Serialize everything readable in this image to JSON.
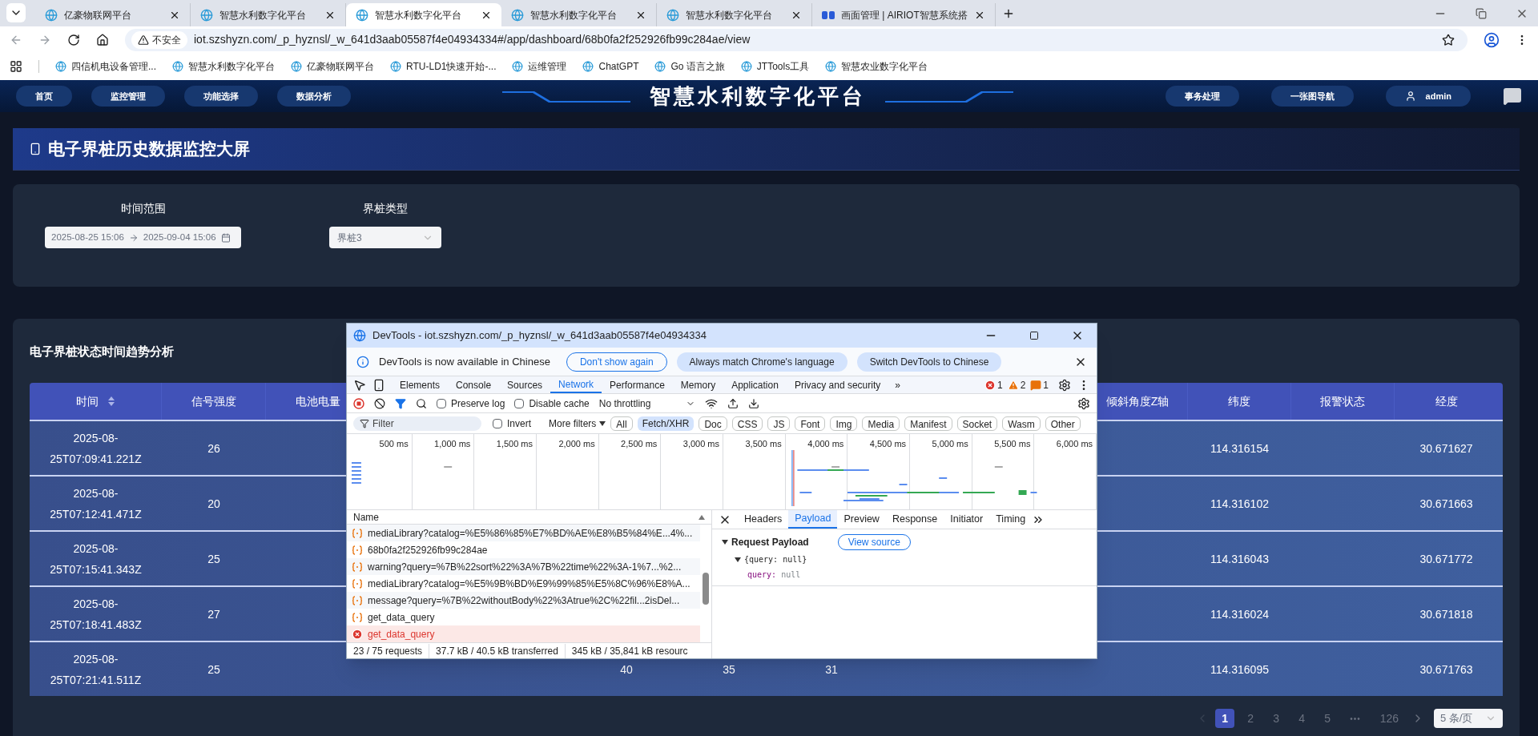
{
  "browser": {
    "tabs": [
      {
        "title": "亿豪物联网平台",
        "selected": false,
        "kind": "globe"
      },
      {
        "title": "智慧水利数字化平台",
        "selected": false,
        "kind": "globe"
      },
      {
        "title": "智慧水利数字化平台",
        "selected": true,
        "kind": "globe"
      },
      {
        "title": "智慧水利数字化平台",
        "selected": false,
        "kind": "globe"
      },
      {
        "title": "智慧水利数字化平台",
        "selected": false,
        "kind": "globe"
      },
      {
        "title": "画面管理 | AIRIOT智慧系统搭",
        "selected": false,
        "kind": "logo"
      }
    ],
    "security": "不安全",
    "url": "iot.szshyzn.com/_p_hyznsl/_w_641d3aab05587f4e04934334#/app/dashboard/68b0fa2f252926fb99c284ae/view",
    "bookmarks": [
      "四信机电设备管理...",
      "智慧水利数字化平台",
      "亿豪物联网平台",
      "RTU-LD1快速开始-...",
      "运维管理",
      "ChatGPT",
      "Go 语言之旅",
      "JTTools工具",
      "智慧农业数字化平台"
    ]
  },
  "app": {
    "nav_left": [
      "首页",
      "监控管理",
      "功能选择",
      "数据分析"
    ],
    "title": "智慧水利数字化平台",
    "nav_right": [
      "事务处理",
      "一张图导航"
    ],
    "user": "admin"
  },
  "page_title": "电子界桩历史数据监控大屏",
  "filters": {
    "time_range": {
      "label": "时间范围",
      "start": "2025-08-25 15:06",
      "end": "2025-09-04 15:06"
    },
    "stake_type": {
      "label": "界桩类型",
      "value": "界桩3"
    }
  },
  "table_card": {
    "title": "电子界桩状态时间趋势分析",
    "columns": [
      {
        "label": "时间",
        "sortable": true
      },
      {
        "label": "信号强度",
        "sortable": false
      },
      {
        "label": "电池电量",
        "sortable": false
      },
      null,
      null,
      null,
      null,
      null,
      null,
      null,
      {
        "label": "倾斜角度Z轴",
        "sortable": false
      },
      {
        "label": "纬度",
        "sortable": false
      },
      {
        "label": "报警状态",
        "sortable": false
      },
      {
        "label": "经度",
        "sortable": false
      }
    ],
    "rows": [
      [
        "2025-08-25T07:09:41.221Z",
        "26",
        null,
        null,
        null,
        null,
        null,
        null,
        null,
        null,
        null,
        "114.316154",
        null,
        "30.671627"
      ],
      [
        "2025-08-25T07:12:41.471Z",
        "20",
        null,
        null,
        null,
        null,
        null,
        null,
        null,
        null,
        null,
        "114.316102",
        null,
        "30.671663"
      ],
      [
        "2025-08-25T07:15:41.343Z",
        "25",
        null,
        null,
        null,
        null,
        null,
        null,
        null,
        null,
        null,
        "114.316043",
        null,
        "30.671772"
      ],
      [
        "2025-08-25T07:18:41.483Z",
        "27",
        null,
        null,
        null,
        null,
        null,
        null,
        null,
        null,
        null,
        "114.316024",
        null,
        "30.671818"
      ],
      [
        "2025-08-25T07:21:41.511Z",
        "25",
        null,
        null,
        null,
        "40",
        "35",
        "31",
        null,
        null,
        null,
        "114.316095",
        null,
        "30.671763"
      ]
    ],
    "pagination": {
      "prev_disabled": true,
      "pages": [
        {
          "label": "1",
          "selected": true
        },
        {
          "label": "2",
          "selected": false
        },
        {
          "label": "3",
          "selected": false
        },
        {
          "label": "4",
          "selected": false
        },
        {
          "label": "5",
          "selected": false
        }
      ],
      "ellipsis": "•••",
      "last": "126",
      "page_size": "5 条/页"
    }
  },
  "devtools": {
    "title": "DevTools - iot.szshyzn.com/_p_hyznsl/_w_641d3aab05587f4e04934334",
    "info": {
      "text": "DevTools is now available in Chinese",
      "buttons": [
        {
          "label": "Don't show again",
          "kind": "outline"
        },
        {
          "label": "Always match Chrome's language",
          "kind": "filled"
        },
        {
          "label": "Switch DevTools to Chinese",
          "kind": "filled"
        }
      ]
    },
    "tabs": [
      {
        "label": "Elements",
        "selected": false
      },
      {
        "label": "Console",
        "selected": false
      },
      {
        "label": "Sources",
        "selected": false
      },
      {
        "label": "Network",
        "selected": true
      },
      {
        "label": "Performance",
        "selected": false
      },
      {
        "label": "Memory",
        "selected": false
      },
      {
        "label": "Application",
        "selected": false
      },
      {
        "label": "Privacy and security",
        "selected": false
      }
    ],
    "more": "»",
    "errors": "1",
    "warnings": "2",
    "issues": "1",
    "preserve_log": {
      "label": "Preserve log",
      "checked": false
    },
    "disable_cache": {
      "label": "Disable cache",
      "checked": false
    },
    "throttling": "No throttling",
    "filter": {
      "placeholder": "Filter"
    },
    "invert": {
      "label": "Invert",
      "checked": false
    },
    "more_filters": "More filters",
    "types": [
      {
        "label": "All",
        "selected": false
      },
      {
        "label": "Fetch/XHR",
        "selected": true
      },
      {
        "label": "Doc",
        "selected": false
      },
      {
        "label": "CSS",
        "selected": false
      },
      {
        "label": "JS",
        "selected": false
      },
      {
        "label": "Font",
        "selected": false
      },
      {
        "label": "Img",
        "selected": false
      },
      {
        "label": "Media",
        "selected": false
      },
      {
        "label": "Manifest",
        "selected": false
      },
      {
        "label": "Socket",
        "selected": false
      },
      {
        "label": "Wasm",
        "selected": false
      },
      {
        "label": "Other",
        "selected": false
      }
    ],
    "ticks": [
      "500 ms",
      "1,000 ms",
      "1,500 ms",
      "2,000 ms",
      "2,500 ms",
      "3,000 ms",
      "3,500 ms",
      "4,000 ms",
      "4,500 ms",
      "5,000 ms",
      "5,500 ms",
      "6,000 ms"
    ],
    "name_header": "Name",
    "requests": [
      {
        "name": "mediaLibrary?catalog=%E5%86%85%E7%BD%AE%E8%B5%84%E...4%...",
        "failed": false
      },
      {
        "name": "68b0fa2f252926fb99c284ae",
        "failed": false
      },
      {
        "name": "warning?query=%7B%22sort%22%3A%7B%22time%22%3A-1%7...%2...",
        "failed": false
      },
      {
        "name": "mediaLibrary?catalog=%E5%9B%BD%E9%99%85%E5%8C%96%E8%A...",
        "failed": false
      },
      {
        "name": "message?query=%7B%22withoutBody%22%3Atrue%2C%22fil...2isDel...",
        "failed": false
      },
      {
        "name": "get_data_query",
        "failed": false
      },
      {
        "name": "get_data_query",
        "failed": true
      }
    ],
    "detail_tabs": [
      {
        "label": "Headers",
        "selected": false
      },
      {
        "label": "Payload",
        "selected": true
      },
      {
        "label": "Preview",
        "selected": false
      },
      {
        "label": "Response",
        "selected": false
      },
      {
        "label": "Initiator",
        "selected": false
      },
      {
        "label": "Timing",
        "selected": false
      }
    ],
    "payload": {
      "section": "Request Payload",
      "view_source": "View source",
      "object": "{query: null}",
      "key": "query:",
      "value": "null"
    },
    "status": [
      "23 / 75 requests",
      "37.7 kB / 40.5 kB transferred",
      "345 kB / 35,841 kB resourc"
    ]
  }
}
